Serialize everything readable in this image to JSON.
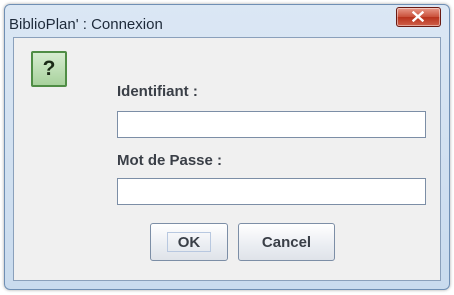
{
  "window": {
    "title": "BiblioPlan' : Connexion"
  },
  "dialog": {
    "icon": "question-icon",
    "icon_glyph": "?",
    "username_label": "Identifiant :",
    "username_value": "",
    "password_label": "Mot de Passe :",
    "password_value": "",
    "ok_label": "OK",
    "cancel_label": "Cancel"
  },
  "colors": {
    "close_button": "#c9503a",
    "icon_background": "#a8d29d",
    "icon_border": "#4f8d45",
    "panel_background": "#f0f0f0"
  }
}
